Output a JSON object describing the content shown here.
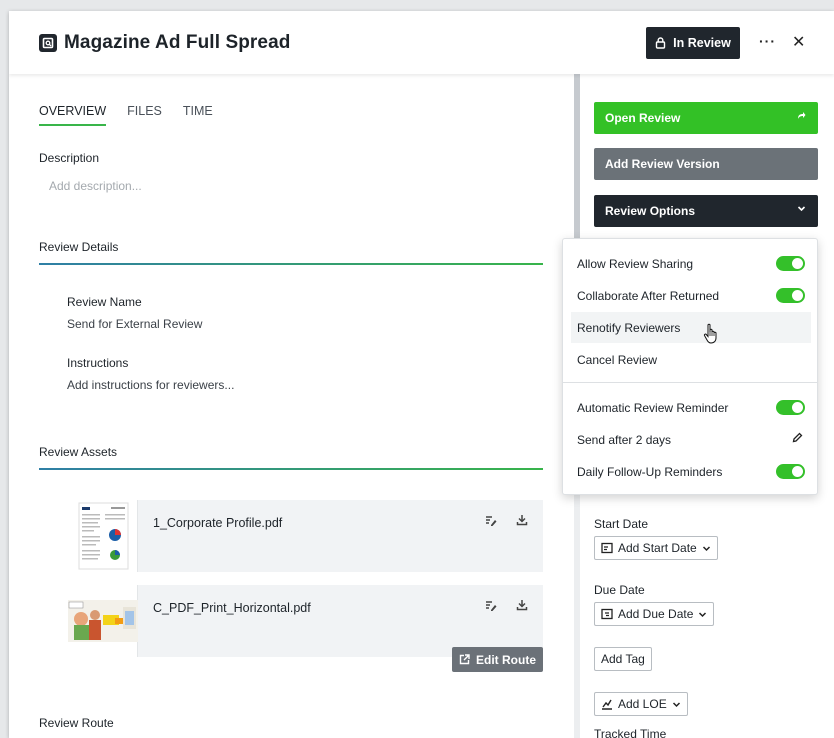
{
  "header": {
    "title": "Magazine Ad Full Spread",
    "status_label": "In Review",
    "more_label": "···",
    "close_label": "✕"
  },
  "tabs": [
    {
      "label": "OVERVIEW",
      "active": true
    },
    {
      "label": "FILES",
      "active": false
    },
    {
      "label": "TIME",
      "active": false
    }
  ],
  "description": {
    "label": "Description",
    "placeholder": "Add description..."
  },
  "review_details": {
    "title": "Review Details",
    "name_label": "Review Name",
    "name_value": "Send for External Review",
    "instructions_label": "Instructions",
    "instructions_placeholder": "Add instructions for reviewers..."
  },
  "review_assets": {
    "title": "Review Assets",
    "items": [
      {
        "name": "1_Corporate Profile.pdf"
      },
      {
        "name": "C_PDF_Print_Horizontal.pdf"
      }
    ]
  },
  "review_route": {
    "title": "Review Route",
    "edit_label": "Edit Route"
  },
  "sidebar": {
    "open_review": "Open Review",
    "add_version": "Add Review Version",
    "review_options": "Review Options",
    "start_date_label": "Start Date",
    "start_date_btn": "Add Start Date",
    "due_date_label": "Due Date",
    "due_date_btn": "Add Due Date",
    "add_tag": "Add Tag",
    "add_loe": "Add LOE",
    "tracked_time": "Tracked Time"
  },
  "review_options_menu": {
    "items": [
      {
        "label": "Allow Review Sharing",
        "toggle": true
      },
      {
        "label": "Collaborate After Returned",
        "toggle": true
      },
      {
        "label": "Renotify Reviewers"
      },
      {
        "label": "Cancel Review"
      },
      {
        "label": "Automatic Review Reminder",
        "toggle": true
      },
      {
        "label": "Send after 2 days"
      },
      {
        "label": "Daily Follow-Up Reminders",
        "toggle": true
      }
    ]
  },
  "colors": {
    "accent_green": "#33c126",
    "dark": "#20262d",
    "gray_button": "#6b7278"
  }
}
